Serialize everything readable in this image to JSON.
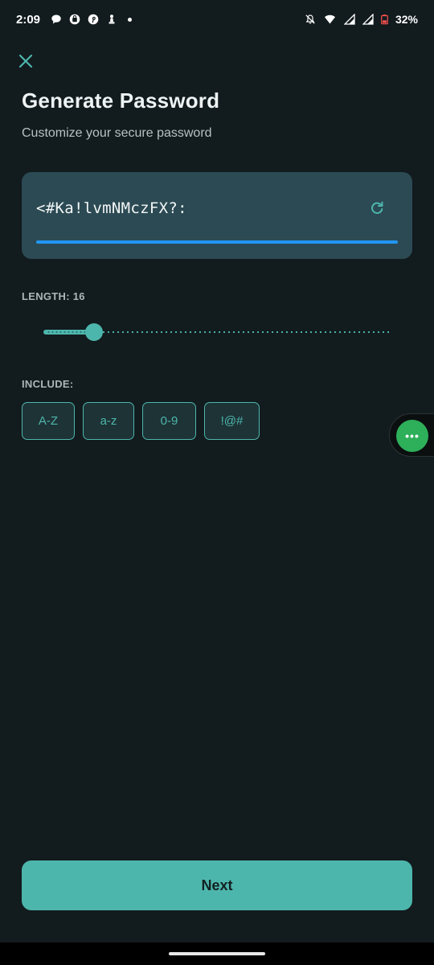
{
  "status_bar": {
    "time": "2:09",
    "battery": "32%",
    "left_icons": [
      "chat-bubble-icon",
      "bag-icon",
      "pinterest-icon",
      "chess-icon",
      "dot-icon"
    ],
    "right_icons": [
      "bell-off-icon",
      "wifi-icon",
      "signal-icon",
      "signal-icon",
      "battery-icon"
    ]
  },
  "header": {
    "close_icon": "close-icon",
    "title": "Generate Password",
    "subtitle": "Customize your secure password"
  },
  "password": {
    "value": "<#Ka!lvmNMczFX?:",
    "refresh_icon": "refresh-icon",
    "strength_fraction": 1.0,
    "strength_color": "#2196f3"
  },
  "length": {
    "label": "LENGTH: 16",
    "value": 16
  },
  "include": {
    "label": "INCLUDE:",
    "options": [
      {
        "label": "A-Z"
      },
      {
        "label": "a-z"
      },
      {
        "label": "0-9"
      },
      {
        "label": "!@#"
      }
    ]
  },
  "floating_bubble": {
    "icon": "more-dots-icon",
    "label": "•••",
    "color": "#2eaf5a"
  },
  "footer": {
    "next_label": "Next"
  },
  "colors": {
    "background": "#121b1e",
    "accent": "#4db6ac",
    "card": "#2c4a54"
  }
}
